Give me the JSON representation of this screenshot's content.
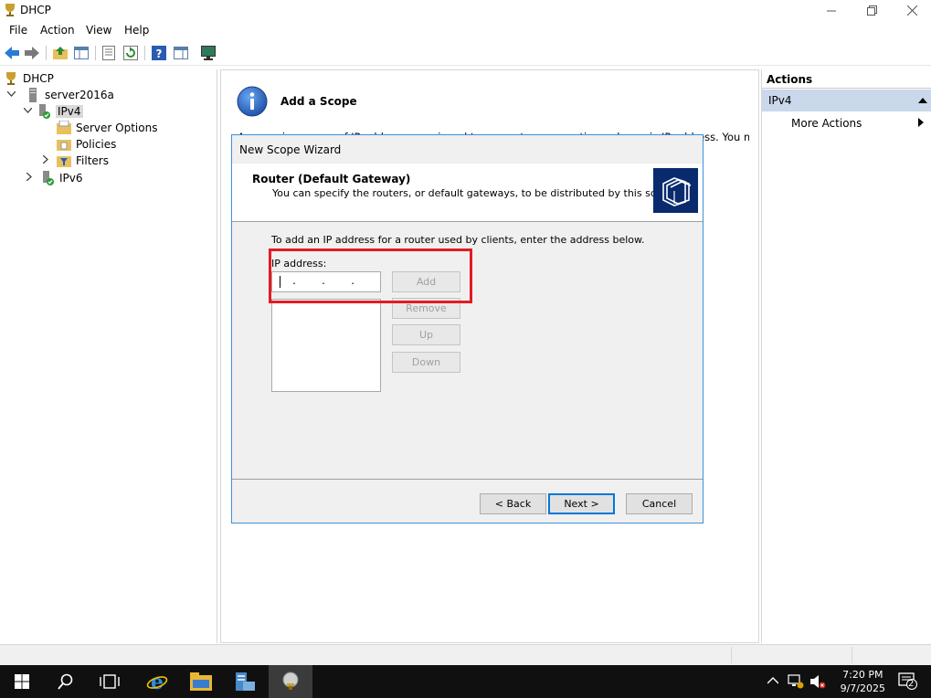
{
  "window": {
    "title": "DHCP"
  },
  "menu": {
    "items": [
      "File",
      "Action",
      "View",
      "Help"
    ]
  },
  "tree": {
    "items": [
      {
        "label": "DHCP"
      },
      {
        "label": "server2016a"
      },
      {
        "label": "IPv4"
      },
      {
        "label": "Server Options"
      },
      {
        "label": "Policies"
      },
      {
        "label": "Filters"
      },
      {
        "label": "IPv6"
      }
    ]
  },
  "center": {
    "title": "Add a Scope",
    "behind_text": "A scope is a range of IP addresses assigned to computers requesting a dynamic IP address. You must"
  },
  "wizard": {
    "window_title": "New Scope Wizard",
    "step_title": "Router (Default Gateway)",
    "step_description": "You can specify the routers, or default gateways, to be distributed by this scope.",
    "instruction": "To add an IP address for a router used by clients, enter the address below.",
    "ip_label": "IP address:",
    "buttons": {
      "add": "Add",
      "remove": "Remove",
      "up": "Up",
      "down": "Down",
      "back": "< Back",
      "next": "Next >",
      "cancel": "Cancel"
    }
  },
  "actions": {
    "title": "Actions",
    "group": "IPv4",
    "more_actions": "More Actions"
  },
  "taskbar": {
    "time": "7:20 PM",
    "date": "9/7/2025",
    "notification_count": "2"
  },
  "colors": {
    "highlight": "#e31b23",
    "dialog_border": "#3e90d6",
    "actions_group_bg": "#c9d8ea",
    "taskbar_bg": "#101010"
  }
}
